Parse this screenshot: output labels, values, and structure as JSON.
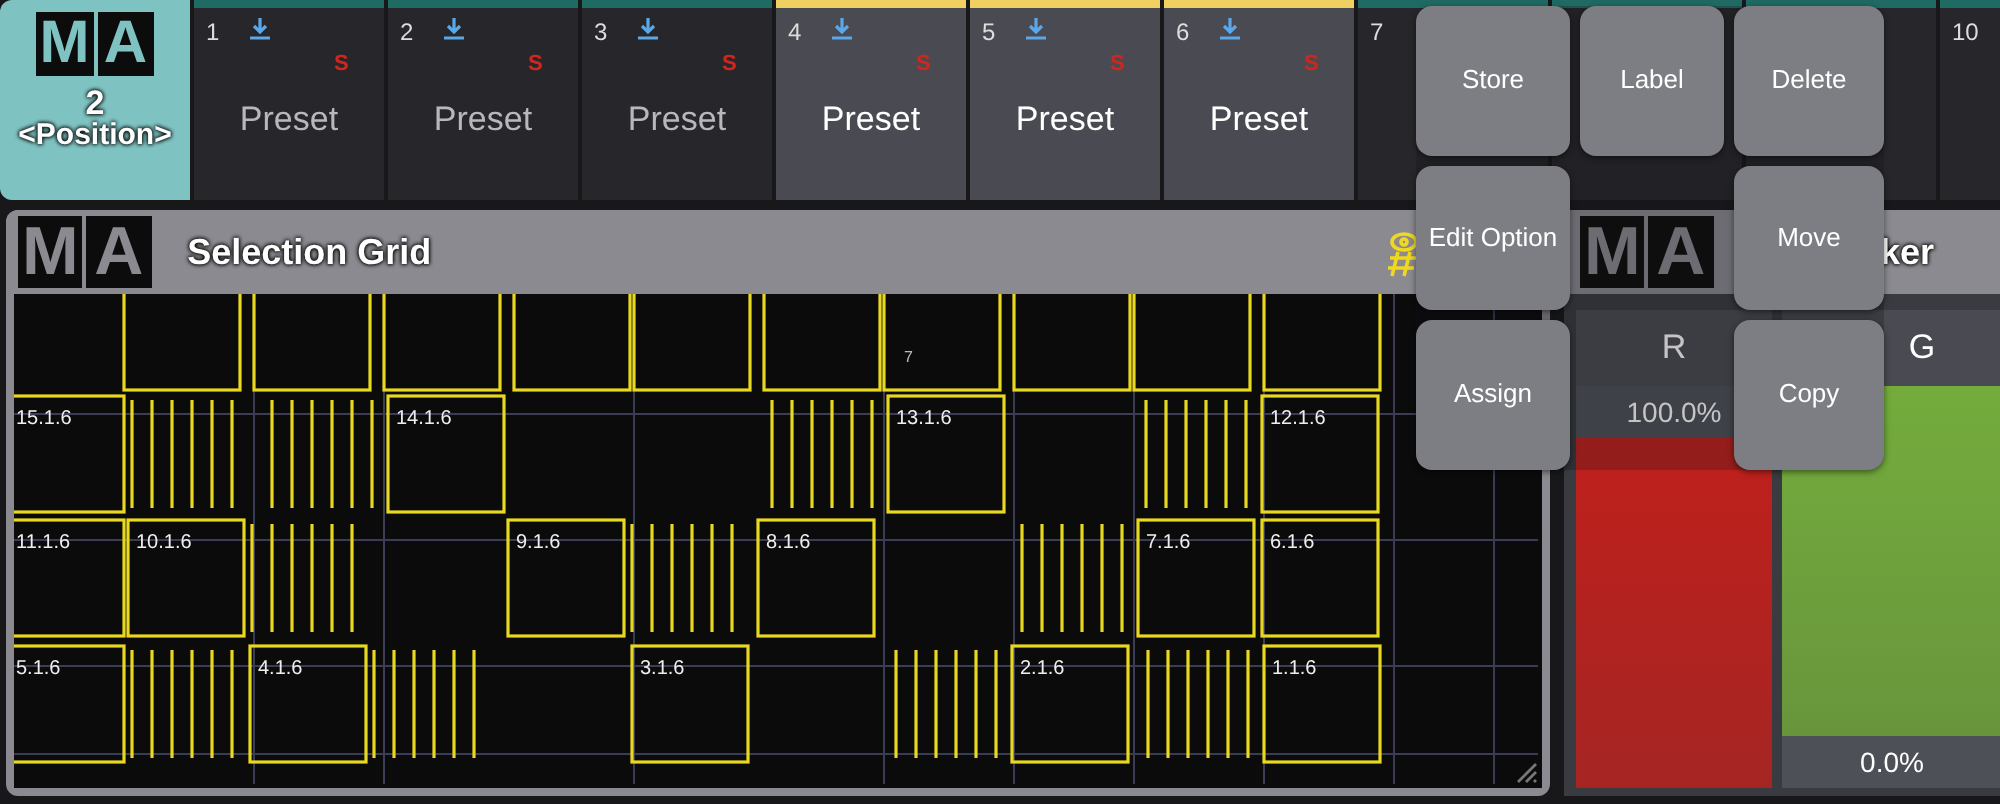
{
  "pool_tile": {
    "logo": [
      "M",
      "A"
    ],
    "number": "2",
    "name": "<Position>"
  },
  "presets": [
    {
      "number": "1",
      "flag": "S",
      "label": "Preset",
      "selected": false
    },
    {
      "number": "2",
      "flag": "S",
      "label": "Preset",
      "selected": false
    },
    {
      "number": "3",
      "flag": "S",
      "label": "Preset",
      "selected": false
    },
    {
      "number": "4",
      "flag": "S",
      "label": "Preset",
      "selected": true
    },
    {
      "number": "5",
      "flag": "S",
      "label": "Preset",
      "selected": true
    },
    {
      "number": "6",
      "flag": "S",
      "label": "Preset",
      "selected": true
    },
    {
      "number": "7",
      "selected": false
    },
    {
      "selected": false
    },
    {
      "selected": false
    },
    {
      "number": "10",
      "selected": false
    }
  ],
  "context_menu": {
    "rows": [
      [
        {
          "kind": "button",
          "label": "Store"
        },
        {
          "kind": "button",
          "label": "Label"
        },
        {
          "kind": "button",
          "label": "Delete"
        }
      ],
      [
        {
          "kind": "button",
          "label": "Edit Option"
        },
        {
          "kind": "gap"
        },
        {
          "kind": "button",
          "label": "Move"
        }
      ],
      [
        {
          "kind": "button",
          "label": "Assign"
        },
        {
          "kind": "gap"
        },
        {
          "kind": "button",
          "label": "Copy"
        }
      ]
    ]
  },
  "selection_grid": {
    "logo": [
      "M",
      "A"
    ],
    "title": "Selection Grid",
    "marker": "7",
    "fixtures": [
      {
        "label": "15.1.6"
      },
      {
        "label": "14.1.6"
      },
      {
        "label": "13.1.6"
      },
      {
        "label": "12.1.6"
      },
      {
        "label": "11.1.6"
      },
      {
        "label": "10.1.6"
      },
      {
        "label": "9.1.6"
      },
      {
        "label": "8.1.6"
      },
      {
        "label": "7.1.6"
      },
      {
        "label": "6.1.6"
      },
      {
        "label": "5.1.6"
      },
      {
        "label": "4.1.6"
      },
      {
        "label": "3.1.6"
      },
      {
        "label": "2.1.6"
      },
      {
        "label": "1.1.6"
      }
    ]
  },
  "color_window": {
    "logo": [
      "M",
      "A"
    ],
    "title": "ker",
    "channels": [
      {
        "name": "R",
        "reading": "100.0%",
        "color": "#c0201c",
        "kind": "top"
      },
      {
        "name": "G",
        "reading": "0.0%",
        "color": "#74ac3c",
        "kind": "bottom"
      }
    ]
  }
}
